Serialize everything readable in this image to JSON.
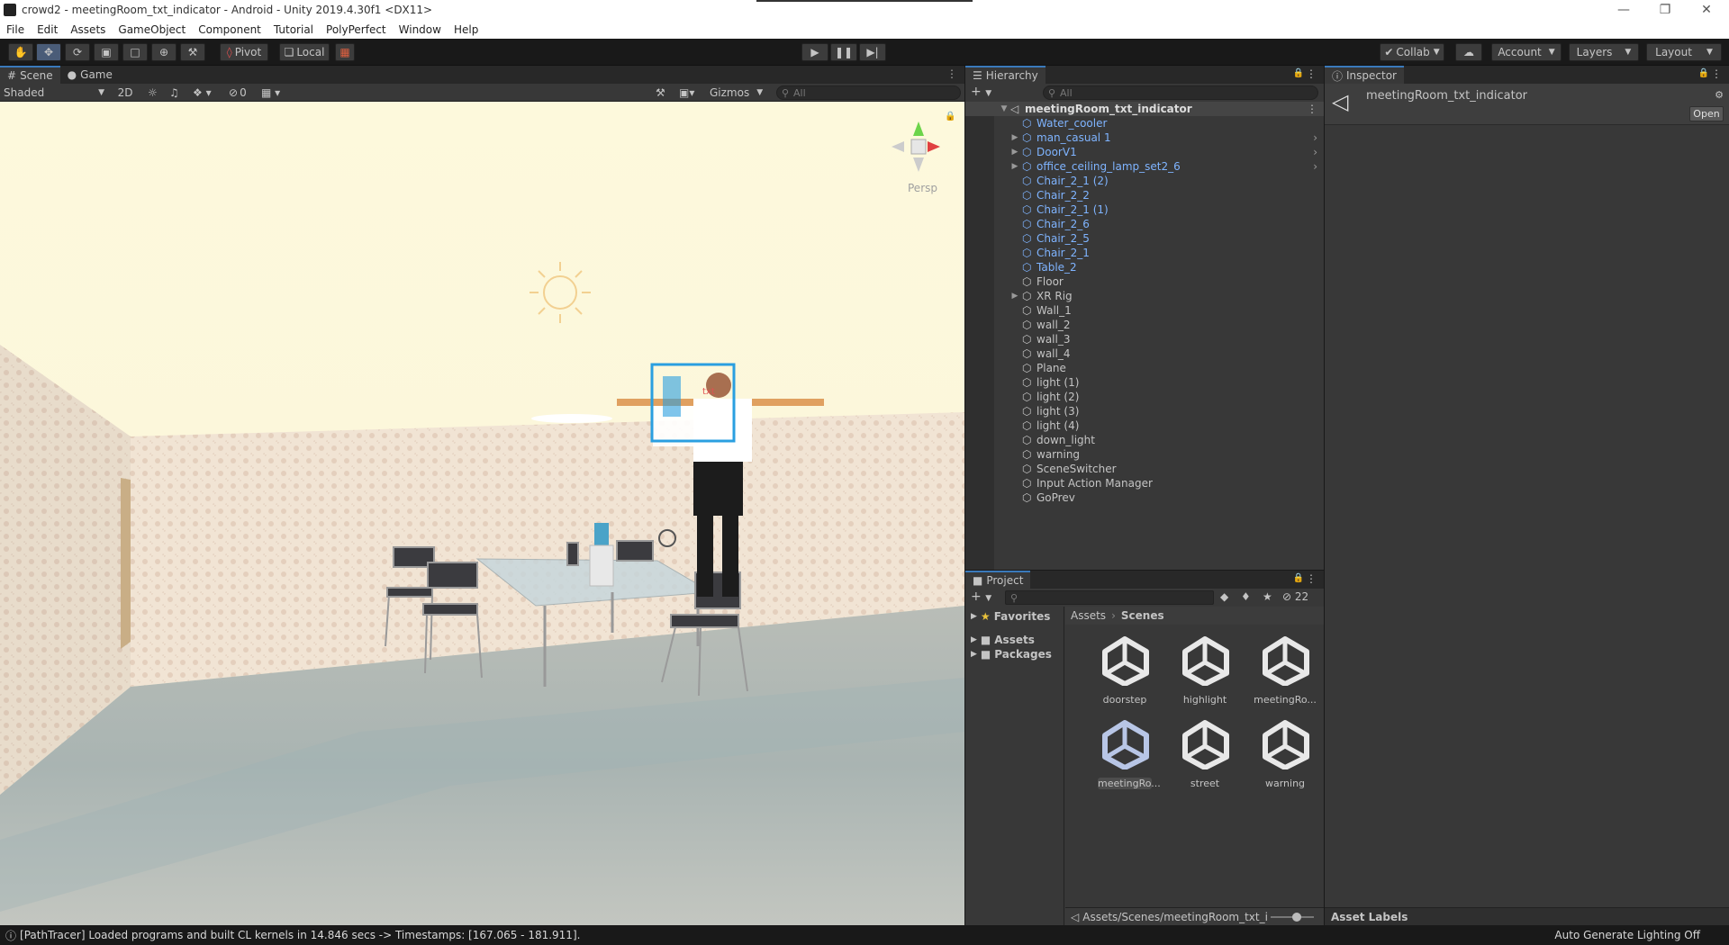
{
  "window": {
    "title": "crowd2 - meetingRoom_txt_indicator - Android - Unity 2019.4.30f1 <DX11>"
  },
  "menu": [
    "File",
    "Edit",
    "Assets",
    "GameObject",
    "Component",
    "Tutorial",
    "PolyPerfect",
    "Window",
    "Help"
  ],
  "toolbar": {
    "pivot": "Pivot",
    "local": "Local",
    "collab": "Collab",
    "account": "Account",
    "layers": "Layers",
    "layout": "Layout"
  },
  "tabs": {
    "scene": "Scene",
    "game": "Game",
    "hierarchy": "Hierarchy",
    "inspector": "Inspector",
    "project": "Project"
  },
  "scene_bar": {
    "shading": "Shaded",
    "mode2d": "2D",
    "hidden_count": "0",
    "gizmos": "Gizmos",
    "search_placeholder": "All",
    "persp": "Persp"
  },
  "hierarchy": {
    "search_placeholder": "All",
    "root": "meetingRoom_txt_indicator",
    "items": [
      {
        "label": "Water_cooler",
        "prefab": true,
        "expandable": false,
        "chevron": false
      },
      {
        "label": "man_casual 1",
        "prefab": true,
        "expandable": true,
        "chevron": true
      },
      {
        "label": "DoorV1",
        "prefab": true,
        "expandable": true,
        "chevron": true
      },
      {
        "label": "office_ceiling_lamp_set2_6",
        "prefab": true,
        "expandable": true,
        "chevron": true
      },
      {
        "label": "Chair_2_1 (2)",
        "prefab": true,
        "expandable": false,
        "chevron": false
      },
      {
        "label": "Chair_2_2",
        "prefab": true,
        "expandable": false,
        "chevron": false
      },
      {
        "label": "Chair_2_1 (1)",
        "prefab": true,
        "expandable": false,
        "chevron": false
      },
      {
        "label": "Chair_2_6",
        "prefab": true,
        "expandable": false,
        "chevron": false
      },
      {
        "label": "Chair_2_5",
        "prefab": true,
        "expandable": false,
        "chevron": false
      },
      {
        "label": "Chair_2_1",
        "prefab": true,
        "expandable": false,
        "chevron": false
      },
      {
        "label": "Table_2",
        "prefab": true,
        "expandable": false,
        "chevron": false
      },
      {
        "label": "Floor",
        "prefab": false,
        "expandable": false,
        "chevron": false
      },
      {
        "label": "XR Rig",
        "prefab": false,
        "expandable": true,
        "chevron": false
      },
      {
        "label": "Wall_1",
        "prefab": false,
        "expandable": false,
        "chevron": false
      },
      {
        "label": "wall_2",
        "prefab": false,
        "expandable": false,
        "chevron": false
      },
      {
        "label": "wall_3",
        "prefab": false,
        "expandable": false,
        "chevron": false
      },
      {
        "label": "wall_4",
        "prefab": false,
        "expandable": false,
        "chevron": false
      },
      {
        "label": "Plane",
        "prefab": false,
        "expandable": false,
        "chevron": false
      },
      {
        "label": "light (1)",
        "prefab": false,
        "expandable": false,
        "chevron": false
      },
      {
        "label": "light (2)",
        "prefab": false,
        "expandable": false,
        "chevron": false
      },
      {
        "label": "light (3)",
        "prefab": false,
        "expandable": false,
        "chevron": false
      },
      {
        "label": "light (4)",
        "prefab": false,
        "expandable": false,
        "chevron": false
      },
      {
        "label": "down_light",
        "prefab": false,
        "expandable": false,
        "chevron": false
      },
      {
        "label": "warning",
        "prefab": false,
        "expandable": false,
        "chevron": false
      },
      {
        "label": "SceneSwitcher",
        "prefab": false,
        "expandable": false,
        "chevron": false
      },
      {
        "label": "Input Action Manager",
        "prefab": false,
        "expandable": false,
        "chevron": false
      },
      {
        "label": "GoPrev",
        "prefab": false,
        "expandable": false,
        "chevron": false
      }
    ]
  },
  "project": {
    "hidden_count": "22",
    "favorites": "Favorites",
    "tree": [
      "Assets",
      "Packages"
    ],
    "breadcrumb": [
      "Assets",
      "Scenes"
    ],
    "assets": [
      {
        "label": "doorstep",
        "selected": false
      },
      {
        "label": "highlight",
        "selected": false
      },
      {
        "label": "meetingRo...",
        "selected": false
      },
      {
        "label": "meetingRo...",
        "selected": true
      },
      {
        "label": "street",
        "selected": false
      },
      {
        "label": "warning",
        "selected": false
      }
    ],
    "path": "Assets/Scenes/meetingRoom_txt_i"
  },
  "inspector": {
    "object_name": "meetingRoom_txt_indicator",
    "open_button": "Open",
    "asset_labels": "Asset Labels"
  },
  "status": {
    "message": "[PathTracer] Loaded programs and built CL kernels in 14.846 secs -> Timestamps: [167.065 - 181.911].",
    "lighting": "Auto Generate Lighting Off"
  },
  "colors": {
    "accent": "#3a79bb",
    "prefab_text": "#7fb4ff",
    "panel_bg": "#383838",
    "dark_bg": "#191919"
  }
}
